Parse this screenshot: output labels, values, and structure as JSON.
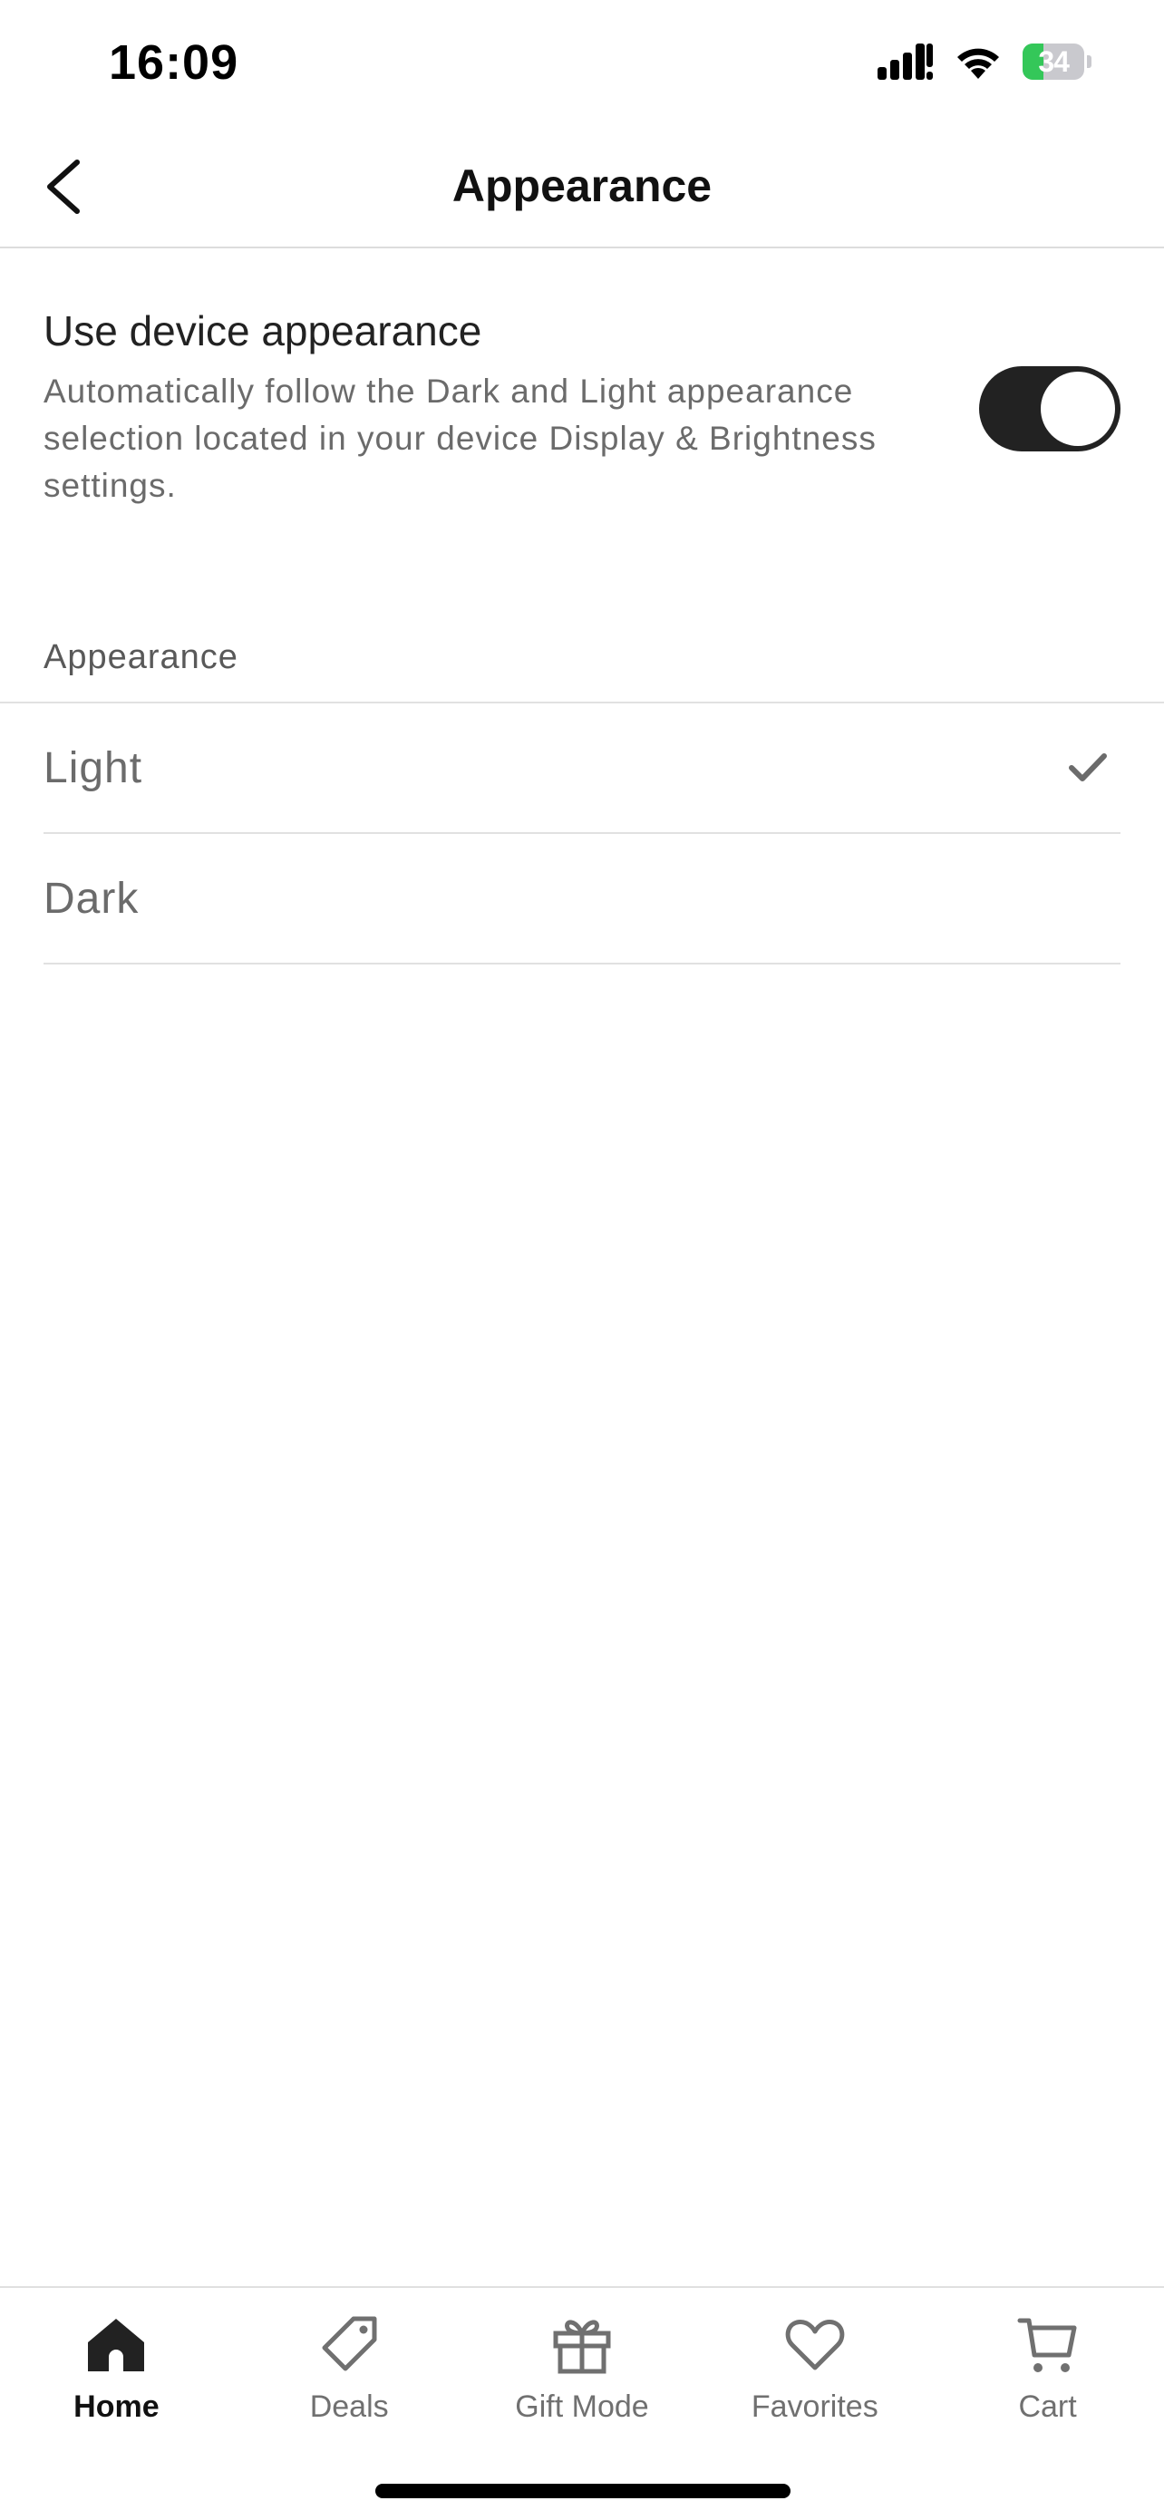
{
  "status_bar": {
    "time": "16:09",
    "battery_percent": 34,
    "battery_label": "34",
    "battery_color": "#34c759"
  },
  "header": {
    "title": "Appearance",
    "back_icon": "chevron-left-icon"
  },
  "device_appearance": {
    "title": "Use device appearance",
    "description": "Automatically follow the Dark and Light appearance selection located in your device Display & Brightness settings.",
    "enabled": true,
    "toggle_color": "#222222"
  },
  "appearance_section": {
    "label": "Appearance",
    "options": [
      {
        "label": "Light",
        "selected": true
      },
      {
        "label": "Dark",
        "selected": false
      }
    ]
  },
  "tab_bar": {
    "tabs": [
      {
        "label": "Home",
        "icon": "home-icon",
        "active": true
      },
      {
        "label": "Deals",
        "icon": "tag-icon",
        "active": false
      },
      {
        "label": "Gift Mode",
        "icon": "gift-icon",
        "active": false
      },
      {
        "label": "Favorites",
        "icon": "heart-icon",
        "active": false
      },
      {
        "label": "Cart",
        "icon": "cart-icon",
        "active": false
      }
    ]
  }
}
